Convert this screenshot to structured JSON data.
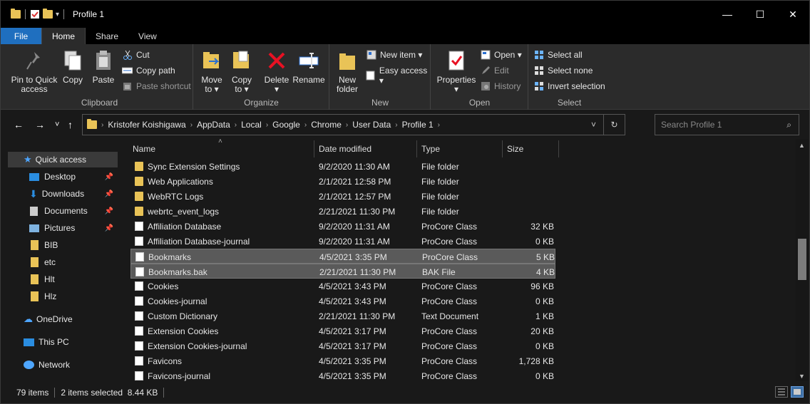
{
  "window": {
    "title": "Profile 1",
    "controls": {
      "minimize": "—",
      "maximize": "☐",
      "close": "✕"
    }
  },
  "tabs": [
    {
      "label": "File"
    },
    {
      "label": "Home"
    },
    {
      "label": "Share"
    },
    {
      "label": "View"
    }
  ],
  "ribbon": {
    "clipboard": {
      "label": "Clipboard",
      "pin": "Pin to Quick access",
      "pin_l1": "Pin to Quick",
      "pin_l2": "access",
      "copy": "Copy",
      "paste": "Paste",
      "cut": "Cut",
      "copy_path": "Copy path",
      "paste_shortcut": "Paste shortcut"
    },
    "organize": {
      "label": "Organize",
      "move_to_l1": "Move",
      "move_to_l2": "to ▾",
      "copy_to_l1": "Copy",
      "copy_to_l2": "to ▾",
      "delete": "Delete",
      "delete_arrow": "▾",
      "rename": "Rename"
    },
    "new": {
      "label": "New",
      "new_folder_l1": "New",
      "new_folder_l2": "folder",
      "new_item": "New item ▾",
      "easy_access": "Easy access ▾"
    },
    "open": {
      "label": "Open",
      "properties": "Properties",
      "properties_arrow": "▾",
      "open": "Open ▾",
      "edit": "Edit",
      "history": "History"
    },
    "select": {
      "label": "Select",
      "select_all": "Select all",
      "select_none": "Select none",
      "invert": "Invert selection"
    }
  },
  "nav": {
    "back": "←",
    "forward": "→",
    "recent": "˅",
    "up": "↑",
    "breadcrumb": [
      "Kristofer Koishigawa",
      "AppData",
      "Local",
      "Google",
      "Chrome",
      "User Data",
      "Profile 1"
    ],
    "search_placeholder": "Search Profile 1"
  },
  "sidebar": {
    "items": [
      {
        "label": "Quick access",
        "icon": "star-icon",
        "selected": true
      },
      {
        "label": "Desktop",
        "icon": "desktop-icon",
        "pinned": true
      },
      {
        "label": "Downloads",
        "icon": "download-icon",
        "pinned": true
      },
      {
        "label": "Documents",
        "icon": "documents-icon",
        "pinned": true
      },
      {
        "label": "Pictures",
        "icon": "pictures-icon",
        "pinned": true
      },
      {
        "label": "BIB",
        "icon": "folder-icon"
      },
      {
        "label": "etc",
        "icon": "folder-icon"
      },
      {
        "label": "Hlt",
        "icon": "folder-icon"
      },
      {
        "label": "Hlz",
        "icon": "folder-icon"
      },
      {
        "label": "OneDrive",
        "icon": "cloud-icon"
      },
      {
        "label": "This PC",
        "icon": "computer-icon"
      },
      {
        "label": "Network",
        "icon": "network-icon"
      }
    ]
  },
  "columns": {
    "name": "Name",
    "date": "Date modified",
    "type": "Type",
    "size": "Size"
  },
  "files": [
    {
      "name": "Sync Extension Settings",
      "date": "9/2/2020 11:30 AM",
      "type": "File folder",
      "size": "",
      "kind": "folder"
    },
    {
      "name": "Web Applications",
      "date": "2/1/2021 12:58 PM",
      "type": "File folder",
      "size": "",
      "kind": "folder"
    },
    {
      "name": "WebRTC Logs",
      "date": "2/1/2021 12:57 PM",
      "type": "File folder",
      "size": "",
      "kind": "folder"
    },
    {
      "name": "webrtc_event_logs",
      "date": "2/21/2021 11:30 PM",
      "type": "File folder",
      "size": "",
      "kind": "folder"
    },
    {
      "name": "Affiliation Database",
      "date": "9/2/2020 11:31 AM",
      "type": "ProCore Class",
      "size": "32 KB",
      "kind": "file"
    },
    {
      "name": "Affiliation Database-journal",
      "date": "9/2/2020 11:31 AM",
      "type": "ProCore Class",
      "size": "0 KB",
      "kind": "file"
    },
    {
      "name": "Bookmarks",
      "date": "4/5/2021 3:35 PM",
      "type": "ProCore Class",
      "size": "5 KB",
      "kind": "file",
      "selected": true
    },
    {
      "name": "Bookmarks.bak",
      "date": "2/21/2021 11:30 PM",
      "type": "BAK File",
      "size": "4 KB",
      "kind": "file",
      "selected": true
    },
    {
      "name": "Cookies",
      "date": "4/5/2021 3:43 PM",
      "type": "ProCore Class",
      "size": "96 KB",
      "kind": "file"
    },
    {
      "name": "Cookies-journal",
      "date": "4/5/2021 3:43 PM",
      "type": "ProCore Class",
      "size": "0 KB",
      "kind": "file"
    },
    {
      "name": "Custom Dictionary",
      "date": "2/21/2021 11:30 PM",
      "type": "Text Document",
      "size": "1 KB",
      "kind": "txt"
    },
    {
      "name": "Extension Cookies",
      "date": "4/5/2021 3:17 PM",
      "type": "ProCore Class",
      "size": "20 KB",
      "kind": "file"
    },
    {
      "name": "Extension Cookies-journal",
      "date": "4/5/2021 3:17 PM",
      "type": "ProCore Class",
      "size": "0 KB",
      "kind": "file"
    },
    {
      "name": "Favicons",
      "date": "4/5/2021 3:35 PM",
      "type": "ProCore Class",
      "size": "1,728 KB",
      "kind": "file"
    },
    {
      "name": "Favicons-journal",
      "date": "4/5/2021 3:35 PM",
      "type": "ProCore Class",
      "size": "0 KB",
      "kind": "file"
    }
  ],
  "status": {
    "count": "79 items",
    "selection": "2 items selected  8.44 KB"
  },
  "colors": {
    "accent": "#1f6fbf",
    "folder": "#e9c357",
    "selection": "#5a5a5a"
  }
}
